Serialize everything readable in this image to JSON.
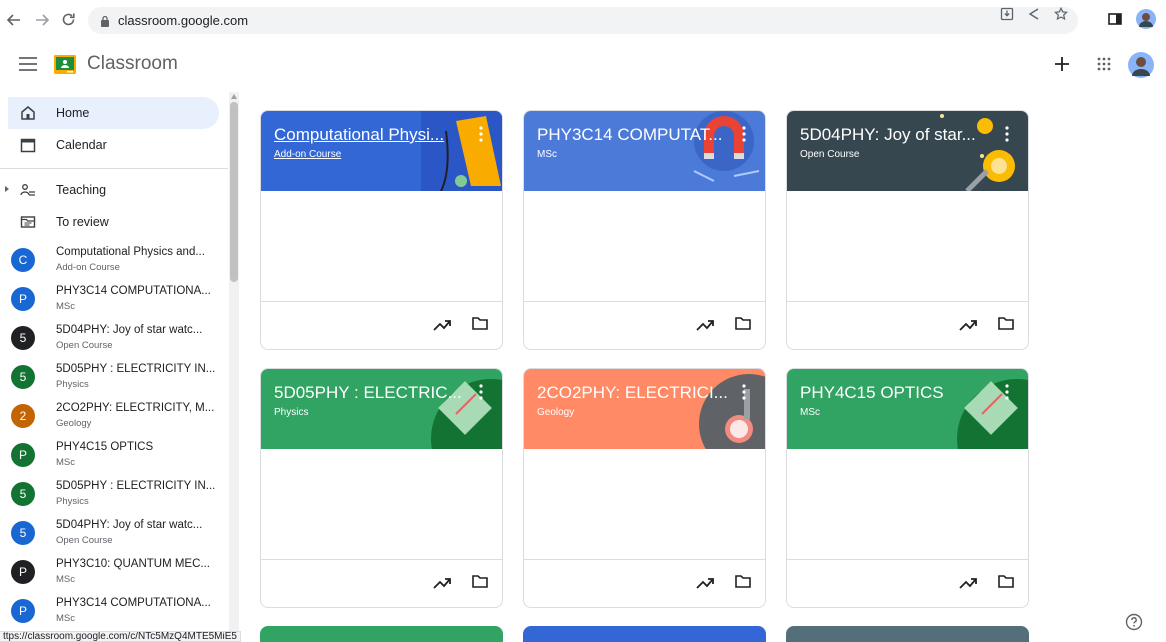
{
  "browser": {
    "url": "classroom.google.com",
    "status_url": "ttps://classroom.google.com/c/NTc5MzQ4MTE5MiE5"
  },
  "header": {
    "title": "Classroom"
  },
  "sidebar": {
    "home": "Home",
    "calendar": "Calendar",
    "teaching": "Teaching",
    "to_review": "To review",
    "courses": [
      {
        "letter": "C",
        "name": "Computational Physics and...",
        "sub": "Add-on Course",
        "color": "#1967d2"
      },
      {
        "letter": "P",
        "name": "PHY3C14 COMPUTATIONA...",
        "sub": "MSc",
        "color": "#1967d2"
      },
      {
        "letter": "5",
        "name": "5D04PHY: Joy of star watc...",
        "sub": "Open Course",
        "color": "#202124"
      },
      {
        "letter": "5",
        "name": "5D05PHY : ELECTRICITY IN...",
        "sub": "Physics",
        "color": "#137333"
      },
      {
        "letter": "2",
        "name": "2CO2PHY: ELECTRICITY, M...",
        "sub": "Geology",
        "color": "#c26401"
      },
      {
        "letter": "P",
        "name": "PHY4C15 OPTICS",
        "sub": "MSc",
        "color": "#137333"
      },
      {
        "letter": "5",
        "name": "5D05PHY : ELECTRICITY IN...",
        "sub": "Physics",
        "color": "#137333"
      },
      {
        "letter": "5",
        "name": "5D04PHY: Joy of star watc...",
        "sub": "Open Course",
        "color": "#1967d2"
      },
      {
        "letter": "P",
        "name": "PHY3C10: QUANTUM MEC...",
        "sub": "MSc",
        "color": "#202124"
      },
      {
        "letter": "P",
        "name": "PHY3C14 COMPUTATIONA...",
        "sub": "MSc",
        "color": "#1967d2"
      }
    ]
  },
  "cards": [
    {
      "title": "Computational Physi...",
      "sub": "Add-on Course",
      "color": "#3367d6"
    },
    {
      "title": "PHY3C14 COMPUTAT...",
      "sub": "MSc",
      "color": "#4c7ad8"
    },
    {
      "title": "5D04PHY: Joy of star...",
      "sub": "Open Course",
      "color": "#37474f"
    },
    {
      "title": "5D05PHY : ELECTRIC...",
      "sub": "Physics",
      "color": "#31a362"
    },
    {
      "title": "2CO2PHY: ELECTRICI...",
      "sub": "Geology",
      "color": "#ff8a65"
    },
    {
      "title": "PHY4C15 OPTICS",
      "sub": "MSc",
      "color": "#31a362"
    }
  ],
  "icons": [
    "back-icon",
    "forward-icon",
    "reload-icon",
    "lock-icon",
    "install-icon",
    "share-icon",
    "star-icon",
    "sidepanel-icon",
    "hamburger-icon",
    "classroom-logo-icon",
    "plus-icon",
    "apps-icon",
    "more-vert-icon",
    "trending-icon",
    "folder-icon",
    "help-icon"
  ]
}
